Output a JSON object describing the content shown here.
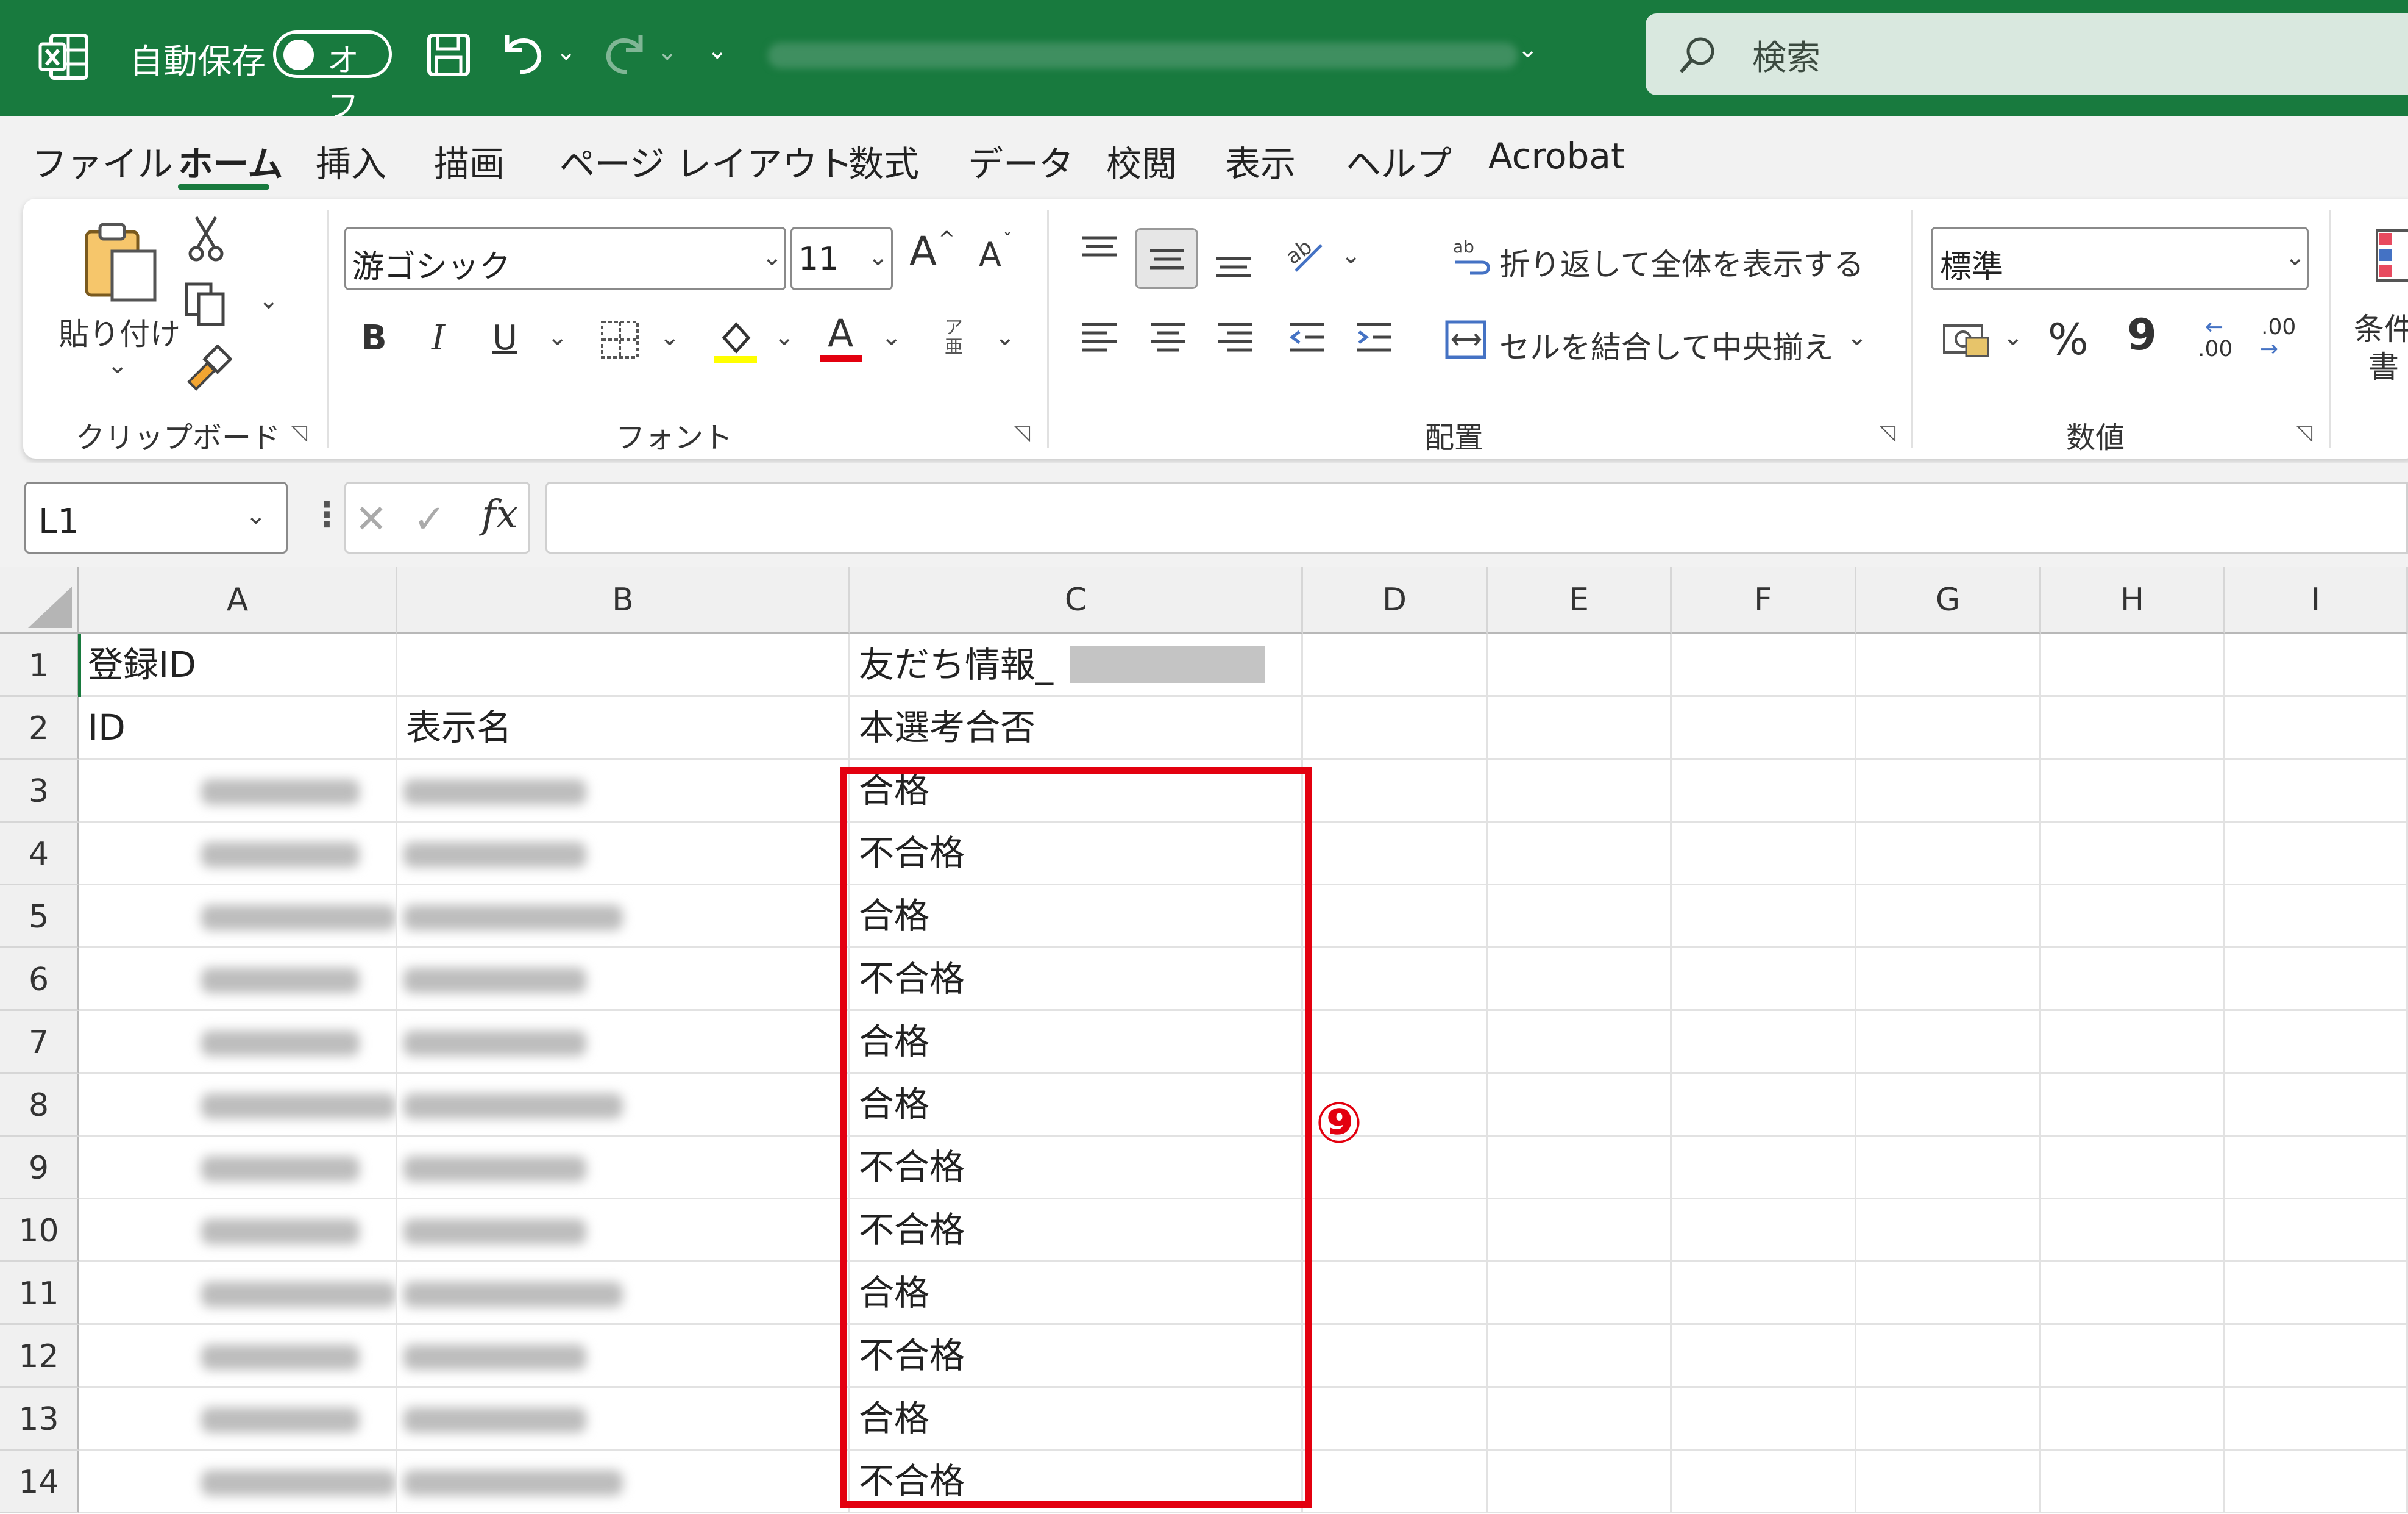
{
  "titlebar": {
    "autosave_label": "自動保存",
    "autosave_state": "オフ",
    "search_label": "検索",
    "accent": "#187A3E"
  },
  "tabs": [
    "ファイル",
    "ホーム",
    "挿入",
    "描画",
    "ページ レイアウト",
    "数式",
    "データ",
    "校閲",
    "表示",
    "ヘルプ",
    "Acrobat"
  ],
  "ribbon": {
    "clipboard": {
      "paste_label": "貼り付け",
      "group_label": "クリップボード"
    },
    "font": {
      "family": "游ゴシック",
      "size": "11",
      "grow": "A",
      "shrink": "A",
      "bold": "B",
      "italic": "I",
      "underline": "U",
      "font_color_glyph": "A",
      "phonetic_glyph": "ア亜",
      "group_label": "フォント"
    },
    "alignment": {
      "wrap_text": "折り返して全体を表示する",
      "merge_center": "セルを結合して中央揃え",
      "group_label": "配置"
    },
    "number": {
      "format": "標準",
      "percent": "%",
      "comma": "9",
      "inc_decimal": ".00",
      "dec_decimal": ".00",
      "group_label": "数値"
    },
    "styles": {
      "conditional_line1": "条件",
      "conditional_line2": "書"
    }
  },
  "formula_bar": {
    "name_box": "L1",
    "fx": "fx",
    "value": ""
  },
  "columns": [
    "A",
    "B",
    "C",
    "D",
    "E",
    "F",
    "G",
    "H",
    "I"
  ],
  "rows": [
    {
      "n": "1",
      "a": "登録ID",
      "b": "",
      "c": "友だち情報_"
    },
    {
      "n": "2",
      "a": "ID",
      "b": "表示名",
      "c": "本選考合否"
    },
    {
      "n": "3",
      "a": "",
      "b": "",
      "c": "合格"
    },
    {
      "n": "4",
      "a": "",
      "b": "",
      "c": "不合格"
    },
    {
      "n": "5",
      "a": "",
      "b": "",
      "c": "合格"
    },
    {
      "n": "6",
      "a": "",
      "b": "",
      "c": "不合格"
    },
    {
      "n": "7",
      "a": "",
      "b": "",
      "c": "合格"
    },
    {
      "n": "8",
      "a": "",
      "b": "",
      "c": "合格"
    },
    {
      "n": "9",
      "a": "",
      "b": "",
      "c": "不合格"
    },
    {
      "n": "10",
      "a": "",
      "b": "",
      "c": "不合格"
    },
    {
      "n": "11",
      "a": "",
      "b": "",
      "c": "合格"
    },
    {
      "n": "12",
      "a": "",
      "b": "",
      "c": "不合格"
    },
    {
      "n": "13",
      "a": "",
      "b": "",
      "c": "合格"
    },
    {
      "n": "14",
      "a": "",
      "b": "",
      "c": "不合格"
    }
  ],
  "annotation": {
    "marker": "⑨",
    "color": "#e3000f"
  }
}
